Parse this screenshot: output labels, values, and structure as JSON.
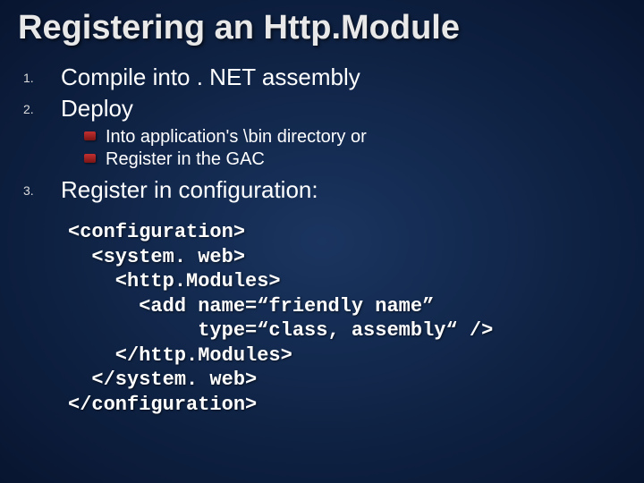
{
  "title": "Registering an Http.Module",
  "items": {
    "1": "Compile into . NET assembly",
    "2": "Deploy",
    "2a": "Into application's \\bin directory or",
    "2b": "Register in the GAC",
    "3": "Register in configuration:"
  },
  "code": "<configuration>\n  <system. web>\n    <http.Modules>\n      <add name=“friendly name”\n           type=“class, assembly“ />\n    </http.Modules>\n  </system. web>\n</configuration>"
}
